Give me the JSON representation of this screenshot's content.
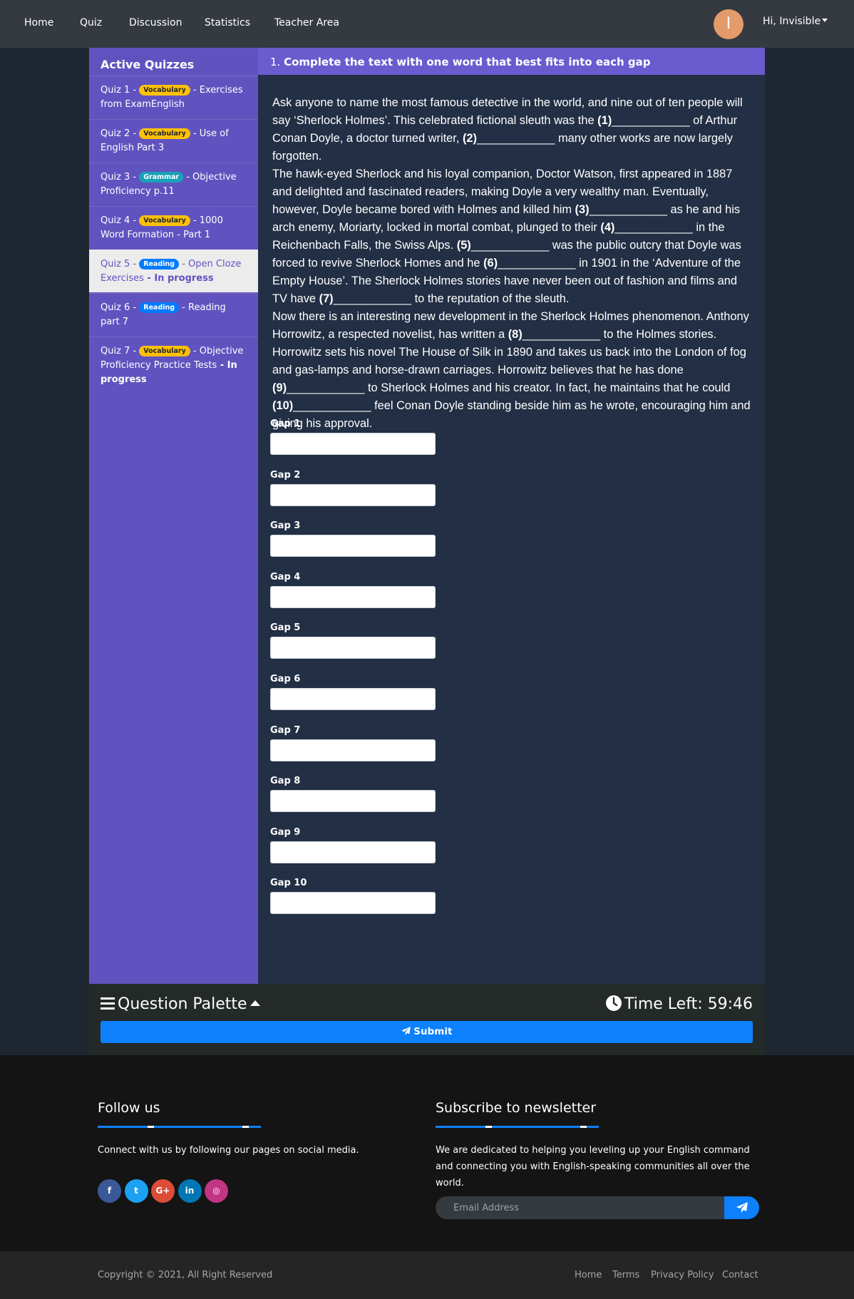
{
  "nav": {
    "links": [
      "Home",
      "Quiz",
      "Discussion",
      "Statistics",
      "Teacher Area"
    ],
    "avatar_initial": "I",
    "user_greeting": "Hi, Invisible"
  },
  "sidebar": {
    "title": "Active Quizzes",
    "quizzes": [
      {
        "prefix": "Quiz 1 - ",
        "badge": "Vocabulary",
        "badge_type": "vocab",
        "suffix": " - Exercises from ExamEnglish",
        "status": ""
      },
      {
        "prefix": "Quiz 2 - ",
        "badge": "Vocabulary",
        "badge_type": "vocab",
        "suffix": " - Use of English Part 3",
        "status": ""
      },
      {
        "prefix": "Quiz 3 - ",
        "badge": "Grammar",
        "badge_type": "grammar",
        "suffix": " - Objective Proficiency p.11",
        "status": ""
      },
      {
        "prefix": "Quiz 4 - ",
        "badge": "Vocabulary",
        "badge_type": "vocab",
        "suffix": " - 1000 Word Formation - Part 1",
        "status": ""
      },
      {
        "prefix": "Quiz 5 - ",
        "badge": "Reading",
        "badge_type": "reading",
        "suffix": " - Open Cloze Exercises",
        "status": " - In progress"
      },
      {
        "prefix": "Quiz 6 - ",
        "badge": "Reading",
        "badge_type": "reading",
        "suffix": " - Reading part 7",
        "status": ""
      },
      {
        "prefix": "Quiz 7 - ",
        "badge": "Vocabulary",
        "badge_type": "vocab",
        "suffix": " - Objective Proficiency Practice Tests",
        "status": " - In progress"
      }
    ],
    "active_index": 4
  },
  "question": {
    "number": "1.",
    "title": "Complete the text with one word that best fits into each gap",
    "blank": "____________",
    "paragraphs": [
      [
        {
          "t": "Ask anyone to name the most famous detective in the world, and nine out of ten people will say ‘Sherlock Holmes’. This celebrated fictional sleuth was the "
        },
        {
          "g": "(1)"
        },
        {
          "t": " of Arthur Conan Doyle, a doctor turned writer, "
        },
        {
          "g": "(2)"
        },
        {
          "t": " many other works are now largely forgotten."
        }
      ],
      [
        {
          "t": "The hawk-eyed Sherlock and his loyal companion, Doctor Watson, first appeared in 1887 and delighted and fascinated readers, making Doyle a very wealthy man. Eventually, however, Doyle became bored with Holmes and killed him "
        },
        {
          "g": "(3)"
        },
        {
          "t": " as he and his arch enemy, Moriarty, locked in mortal combat, plunged to their "
        },
        {
          "g": "(4)"
        },
        {
          "t": " in the Reichenbach Falls, the Swiss Alps. "
        },
        {
          "g": "(5)"
        },
        {
          "t": " was the public outcry that Doyle was forced to revive Sherlock Homes and he "
        },
        {
          "g": "(6)"
        },
        {
          "t": " in 1901 in the ‘Adventure of the Empty House’. The Sherlock Holmes stories have never been out of fashion and films and TV have "
        },
        {
          "g": "(7)"
        },
        {
          "t": " to the reputation of the sleuth."
        }
      ],
      [
        {
          "t": "Now there is an interesting new development in the Sherlock Holmes phenomenon. Anthony Horrowitz, a respected novelist, has written a "
        },
        {
          "g": "(8)"
        },
        {
          "t": " to the Holmes stories. Horrowitz sets his novel The House of Silk in 1890 and takes us back into the London of fog and gas-lamps and horse-drawn carriages. Horrowitz believes that he has done "
        },
        {
          "g": "(9)"
        },
        {
          "t": " to Sherlock Holmes and his creator. In fact, he maintains that he could "
        },
        {
          "g": "(10)"
        },
        {
          "t": " feel Conan Doyle standing beside him as he wrote, encouraging him and giving his approval."
        }
      ]
    ],
    "gaps": [
      "Gap 1",
      "Gap 2",
      "Gap 3",
      "Gap 4",
      "Gap 5",
      "Gap 6",
      "Gap 7",
      "Gap 8",
      "Gap 9",
      "Gap 10"
    ]
  },
  "palette": {
    "title": "Question Palette",
    "time_left": "Time Left: 59:46",
    "submit_label": "Submit"
  },
  "footer": {
    "follow_title": "Follow us",
    "follow_text": "Connect with us by following our pages on social media.",
    "social": [
      {
        "icon": "facebook-icon",
        "glyph": "f",
        "color": "#3b5998"
      },
      {
        "icon": "twitter-icon",
        "glyph": "t",
        "color": "#1da1f2"
      },
      {
        "icon": "google-plus-icon",
        "glyph": "G+",
        "color": "#dd4b39"
      },
      {
        "icon": "linkedin-icon",
        "glyph": "in",
        "color": "#0077b5"
      },
      {
        "icon": "instagram-icon",
        "glyph": "◎",
        "color": "#c13584"
      }
    ],
    "newsletter_title": "Subscribe to newsletter",
    "newsletter_text": "We are dedicated to helping you leveling up your English command and connecting you with English-speaking communities all over the world.",
    "email_placeholder": "Email Address",
    "copyright": "Copyright © 2021, All Right Reserved",
    "links": [
      "Home",
      "Terms",
      "Privacy Policy",
      "Contact"
    ]
  },
  "colors": {
    "nav_bg": "#343a40",
    "sidebar_bg": "#6153bf",
    "content_bg": "#222f44",
    "accent_blue": "#0d80fb",
    "vocab_badge": "#ffc107",
    "grammar_badge": "#17a2b8",
    "reading_badge": "#007bff"
  }
}
